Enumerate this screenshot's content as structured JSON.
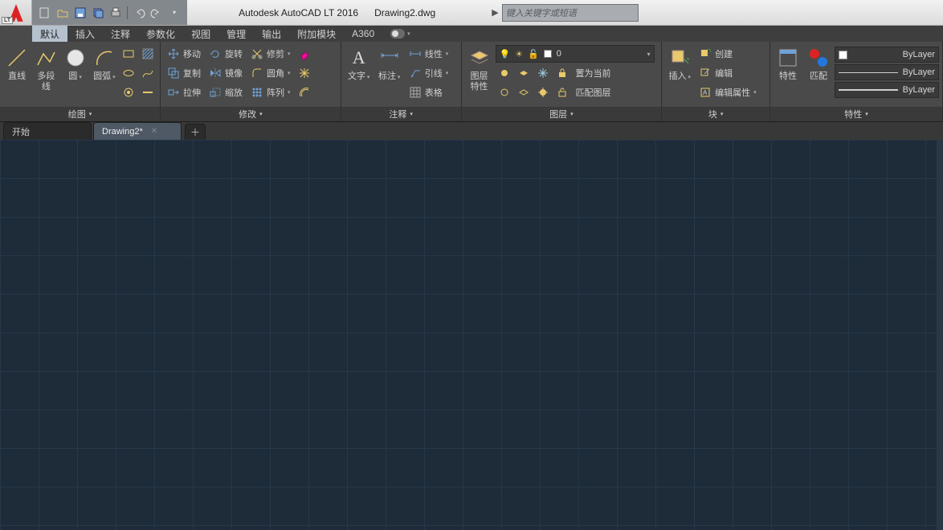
{
  "title": {
    "app": "Autodesk AutoCAD LT 2016",
    "doc": "Drawing2.dwg",
    "logo_badge": "LT"
  },
  "search": {
    "placeholder": "键入关键字或短语"
  },
  "qat": {
    "items": [
      "new",
      "open",
      "save",
      "saveall",
      "print",
      "undo",
      "redo"
    ]
  },
  "menu": {
    "tabs": [
      "默认",
      "插入",
      "注释",
      "参数化",
      "视图",
      "管理",
      "输出",
      "附加模块",
      "A360"
    ],
    "active_index": 0
  },
  "ribbon": {
    "draw": {
      "title": "绘图",
      "big": [
        {
          "id": "line",
          "label": "直线"
        },
        {
          "id": "pline",
          "label": "多段线"
        },
        {
          "id": "circle",
          "label": "圆"
        },
        {
          "id": "arc",
          "label": "圆弧"
        }
      ],
      "small_icons": [
        "rect",
        "hatch",
        "ellipse",
        "spline",
        "donut",
        "point"
      ]
    },
    "modify": {
      "title": "修改",
      "rows": [
        [
          {
            "icon": "move",
            "label": "移动"
          },
          {
            "icon": "rotate",
            "label": "旋转"
          },
          {
            "icon": "trim",
            "label": "修剪",
            "drop": true
          },
          {
            "icon": "erase",
            "label": ""
          }
        ],
        [
          {
            "icon": "copy",
            "label": "复制"
          },
          {
            "icon": "mirror",
            "label": "镜像"
          },
          {
            "icon": "fillet",
            "label": "圆角",
            "drop": true
          },
          {
            "icon": "explode",
            "label": ""
          }
        ],
        [
          {
            "icon": "stretch",
            "label": "拉伸"
          },
          {
            "icon": "scale",
            "label": "缩放"
          },
          {
            "icon": "array",
            "label": "阵列",
            "drop": true
          },
          {
            "icon": "offset",
            "label": ""
          }
        ]
      ]
    },
    "annotate": {
      "title": "注释",
      "big": [
        {
          "id": "text",
          "label": "文字"
        },
        {
          "id": "dim",
          "label": "标注"
        }
      ],
      "rows": [
        {
          "icon": "linear",
          "label": "线性",
          "drop": true
        },
        {
          "icon": "leader",
          "label": "引线",
          "drop": true
        },
        {
          "icon": "table",
          "label": "表格"
        }
      ]
    },
    "layers": {
      "title": "图层",
      "big": {
        "id": "layerprops",
        "label": "图层\n特性"
      },
      "dropdown": {
        "name": "0"
      },
      "rows": [
        [
          {
            "icon": "layoff"
          },
          {
            "icon": "layiso"
          },
          {
            "icon": "layfrz"
          },
          {
            "icon": "laylock"
          },
          {
            "label": "置为当前"
          }
        ],
        [
          {
            "icon": "layon"
          },
          {
            "icon": "layuniso"
          },
          {
            "icon": "laythw"
          },
          {
            "icon": "layunlock"
          },
          {
            "label": "匹配图层"
          }
        ]
      ]
    },
    "block": {
      "title": "块",
      "big": {
        "id": "insert",
        "label": "插入"
      },
      "rows": [
        {
          "icon": "create",
          "label": "创建"
        },
        {
          "icon": "edit",
          "label": "编辑"
        },
        {
          "icon": "editattr",
          "label": "编辑属性",
          "drop": true
        }
      ]
    },
    "properties": {
      "title": "特性",
      "big1": {
        "id": "props",
        "label": "特性"
      },
      "big2": {
        "id": "match",
        "label": "匹配"
      },
      "rows": [
        {
          "type": "color",
          "label": "ByLayer"
        },
        {
          "type": "line",
          "label": "ByLayer"
        },
        {
          "type": "lw",
          "label": "ByLayer"
        }
      ]
    }
  },
  "doctabs": {
    "tabs": [
      {
        "label": "开始",
        "active": false
      },
      {
        "label": "Drawing2*",
        "active": true
      }
    ]
  }
}
